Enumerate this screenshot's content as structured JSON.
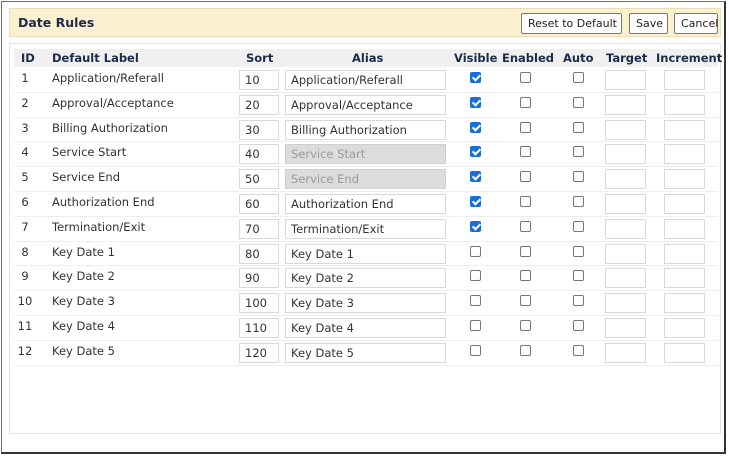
{
  "header": {
    "title": "Date Rules",
    "reset_label": "Reset to Default",
    "save_label": "Save",
    "cancel_label": "Cancel"
  },
  "columns": {
    "id": "ID",
    "default_label": "Default Label",
    "sort": "Sort",
    "alias": "Alias",
    "visible": "Visible",
    "enabled": "Enabled",
    "auto": "Auto",
    "target": "Target",
    "increment": "Increment"
  },
  "rows": [
    {
      "id": "1",
      "label": "Application/Referall",
      "sort": "10",
      "alias": "Application/Referall",
      "alias_disabled": false,
      "visible": true,
      "enabled": false,
      "auto": false,
      "target": "",
      "increment": ""
    },
    {
      "id": "2",
      "label": "Approval/Acceptance",
      "sort": "20",
      "alias": "Approval/Acceptance",
      "alias_disabled": false,
      "visible": true,
      "enabled": false,
      "auto": false,
      "target": "",
      "increment": ""
    },
    {
      "id": "3",
      "label": "Billing Authorization",
      "sort": "30",
      "alias": "Billing Authorization",
      "alias_disabled": false,
      "visible": true,
      "enabled": false,
      "auto": false,
      "target": "",
      "increment": ""
    },
    {
      "id": "4",
      "label": "Service Start",
      "sort": "40",
      "alias": "Service Start",
      "alias_disabled": true,
      "visible": true,
      "enabled": false,
      "auto": false,
      "target": "",
      "increment": ""
    },
    {
      "id": "5",
      "label": "Service End",
      "sort": "50",
      "alias": "Service End",
      "alias_disabled": true,
      "visible": true,
      "enabled": false,
      "auto": false,
      "target": "",
      "increment": ""
    },
    {
      "id": "6",
      "label": "Authorization End",
      "sort": "60",
      "alias": "Authorization End",
      "alias_disabled": false,
      "visible": true,
      "enabled": false,
      "auto": false,
      "target": "",
      "increment": ""
    },
    {
      "id": "7",
      "label": "Termination/Exit",
      "sort": "70",
      "alias": "Termination/Exit",
      "alias_disabled": false,
      "visible": true,
      "enabled": false,
      "auto": false,
      "target": "",
      "increment": ""
    },
    {
      "id": "8",
      "label": "Key Date 1",
      "sort": "80",
      "alias": "Key Date 1",
      "alias_disabled": false,
      "visible": false,
      "enabled": false,
      "auto": false,
      "target": "",
      "increment": ""
    },
    {
      "id": "9",
      "label": "Key Date 2",
      "sort": "90",
      "alias": "Key Date 2",
      "alias_disabled": false,
      "visible": false,
      "enabled": false,
      "auto": false,
      "target": "",
      "increment": ""
    },
    {
      "id": "10",
      "label": "Key Date 3",
      "sort": "100",
      "alias": "Key Date 3",
      "alias_disabled": false,
      "visible": false,
      "enabled": false,
      "auto": false,
      "target": "",
      "increment": ""
    },
    {
      "id": "11",
      "label": "Key Date 4",
      "sort": "110",
      "alias": "Key Date 4",
      "alias_disabled": false,
      "visible": false,
      "enabled": false,
      "auto": false,
      "target": "",
      "increment": ""
    },
    {
      "id": "12",
      "label": "Key Date 5",
      "sort": "120",
      "alias": "Key Date 5",
      "alias_disabled": false,
      "visible": false,
      "enabled": false,
      "auto": false,
      "target": "",
      "increment": ""
    }
  ],
  "colors": {
    "header_bg": "#fdf0d0",
    "checkbox_checked": "#1a6fd6",
    "heading_text": "#1b2b4a",
    "disabled_input": "#dcdcdc"
  }
}
